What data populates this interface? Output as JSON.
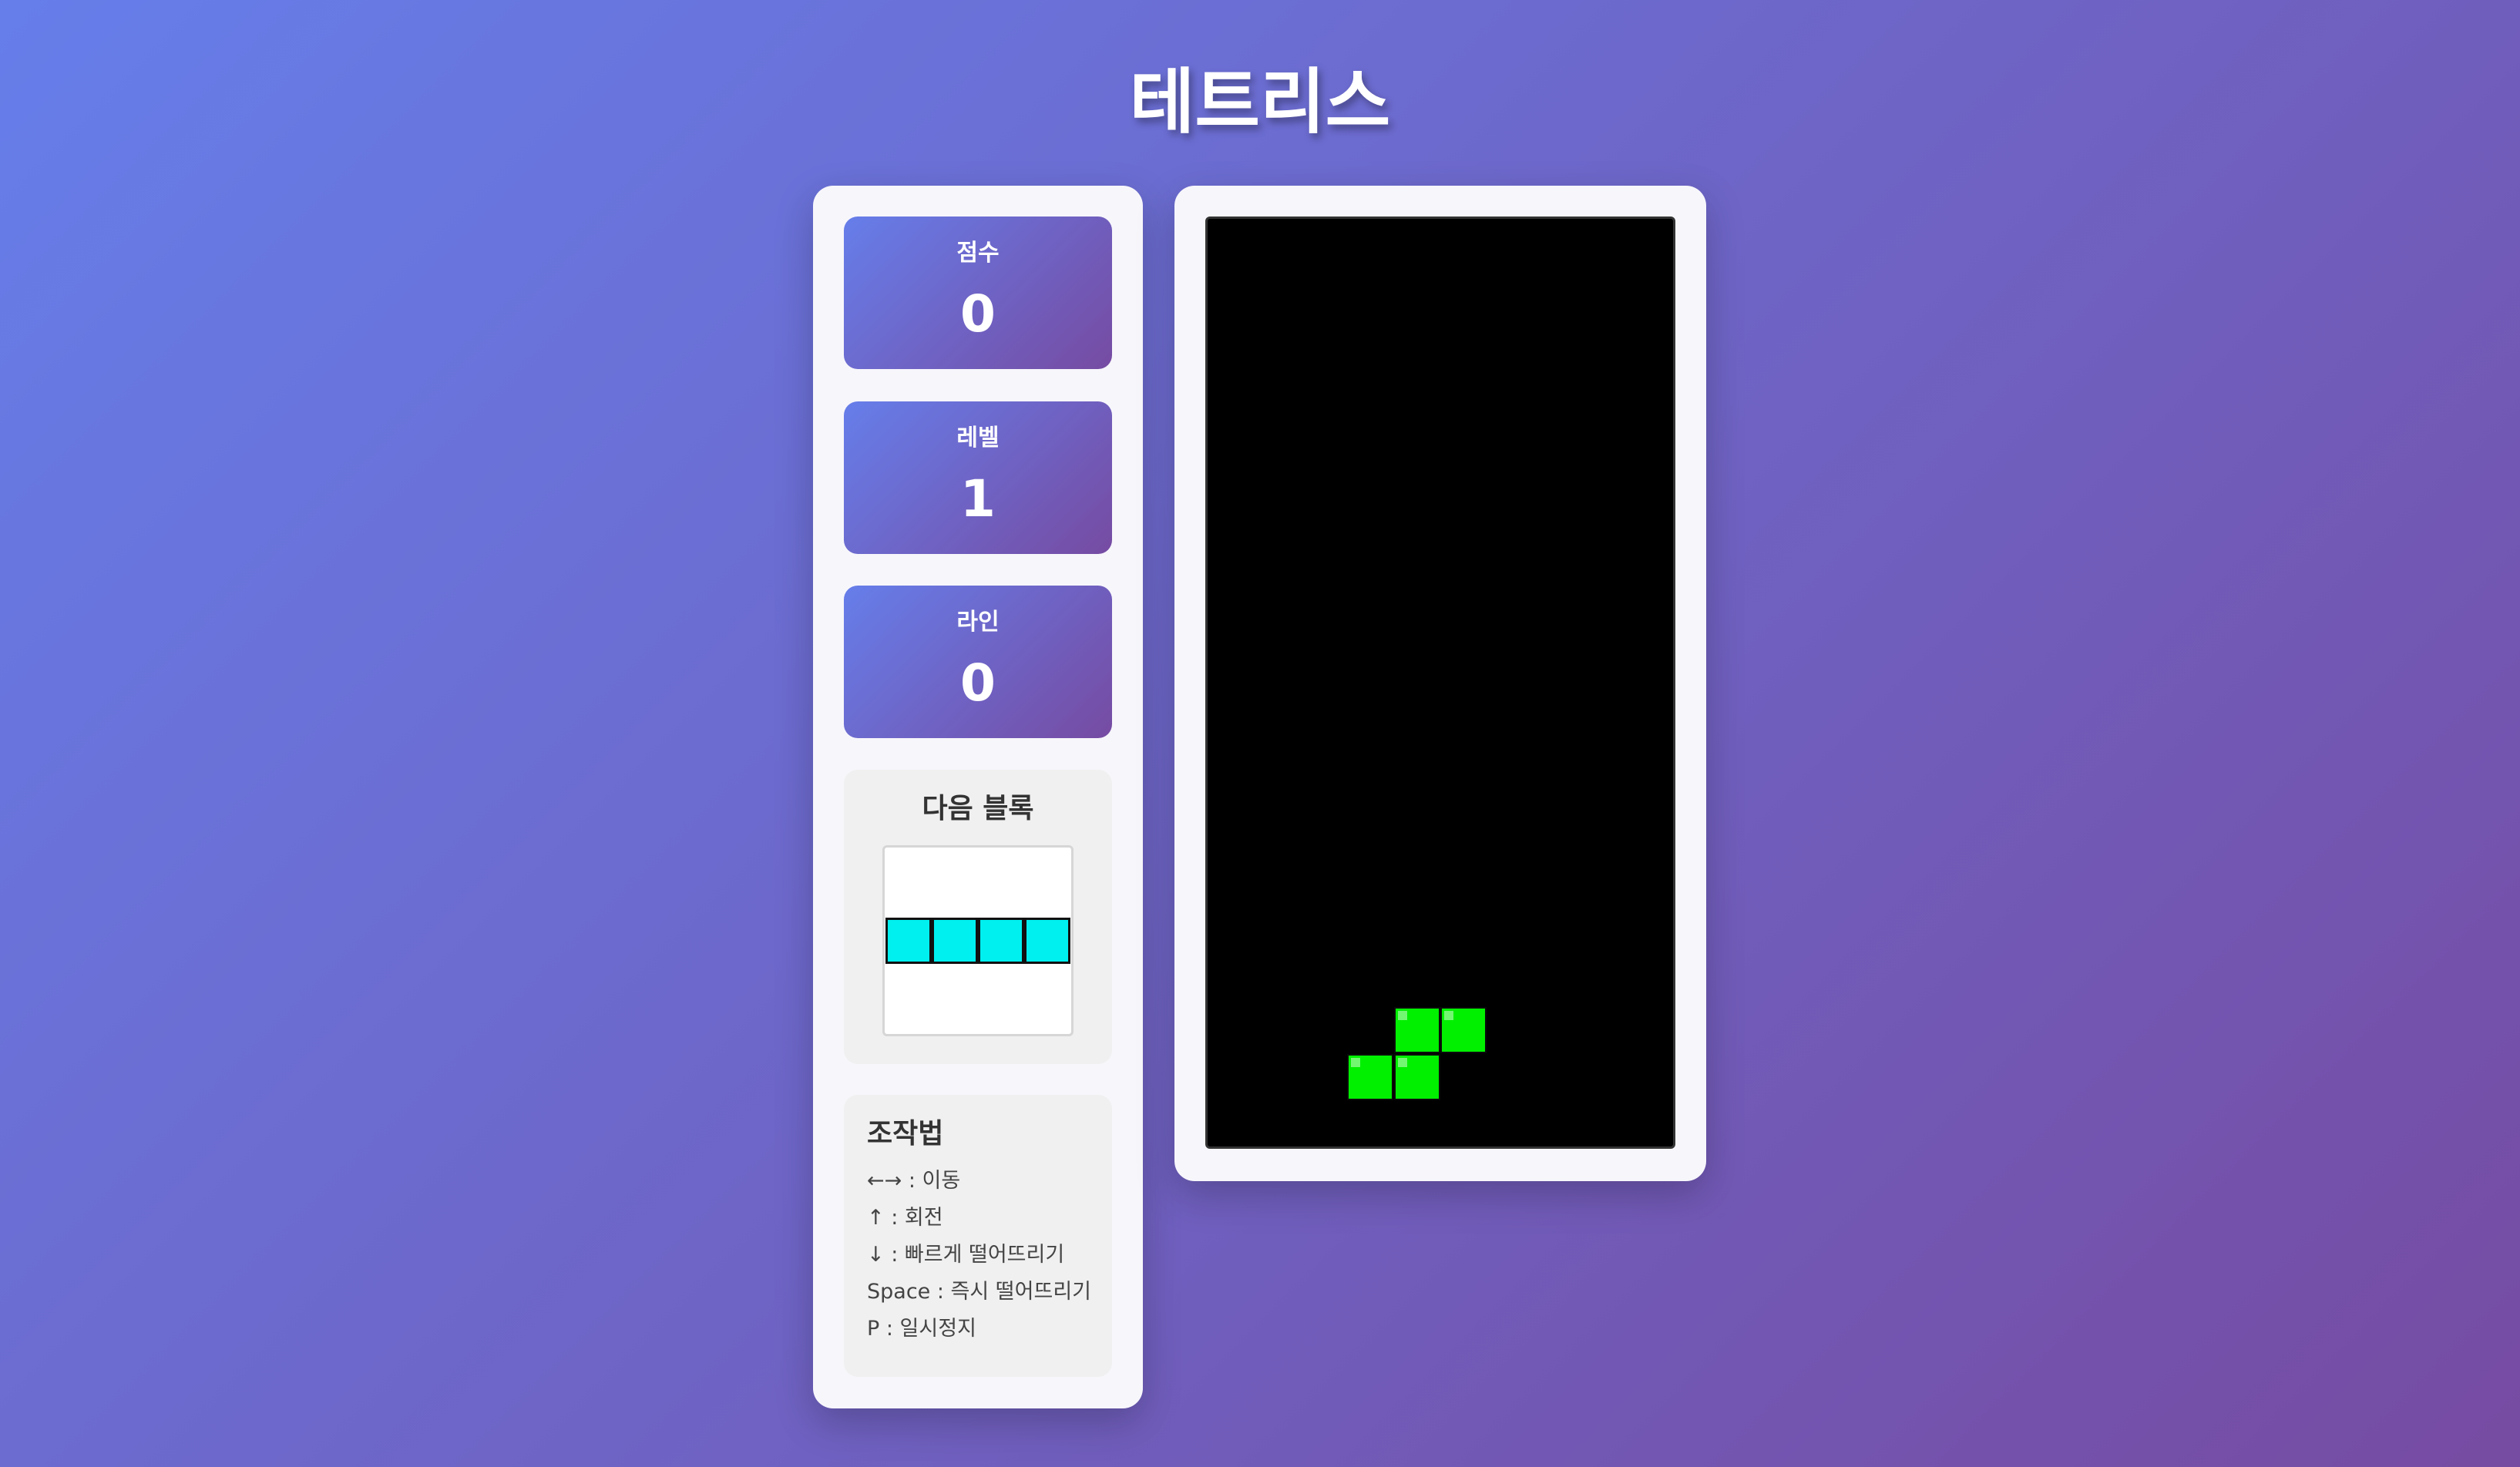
{
  "title": "테트리스",
  "stats": {
    "score": {
      "label": "점수",
      "value": "0"
    },
    "level": {
      "label": "레벨",
      "value": "1"
    },
    "lines": {
      "label": "라인",
      "value": "0"
    }
  },
  "next_block": {
    "title": "다음 블록",
    "piece": "I",
    "color": "#00f0f0"
  },
  "controls": {
    "title": "조작법",
    "lines": [
      "←→ : 이동",
      "↑ : 회전",
      "↓ : 빠르게 떨어뜨리기",
      "Space : 즉시 떨어뜨리기",
      "P : 일시정지"
    ]
  },
  "board": {
    "columns": 10,
    "rows": 20,
    "background": "#000000",
    "current_piece": {
      "type": "S",
      "color": "#00f000",
      "cells": [
        {
          "col": 4,
          "row": 17
        },
        {
          "col": 5,
          "row": 17
        },
        {
          "col": 3,
          "row": 18
        },
        {
          "col": 4,
          "row": 18
        }
      ]
    }
  }
}
